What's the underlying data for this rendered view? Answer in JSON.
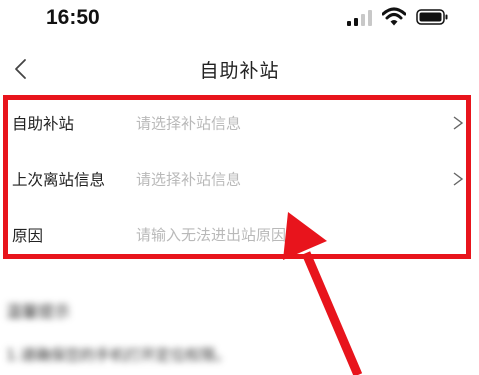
{
  "status_bar": {
    "time": "16:50"
  },
  "header": {
    "title": "自助补站"
  },
  "form": {
    "rows": [
      {
        "label": "自助补站",
        "placeholder": "请选择补站信息",
        "chevron": ">"
      },
      {
        "label": "上次离站信息",
        "placeholder": "请选择补站信息",
        "chevron": ">"
      },
      {
        "label": "原因",
        "placeholder": "请输入无法进出站原因"
      }
    ]
  },
  "blurred": {
    "title": "温馨提示",
    "desc": "1.请确保您的手机打开定位权限。"
  },
  "colors": {
    "annotation_red": "#e8141c",
    "placeholder_gray": "#b9b9b9",
    "text_dark": "#222222"
  },
  "icons": {
    "back": "back-chevron-icon",
    "row_arrow": "chevron-right-icon",
    "signal": "signal-strength-icon",
    "wifi": "wifi-icon",
    "battery": "battery-icon"
  }
}
